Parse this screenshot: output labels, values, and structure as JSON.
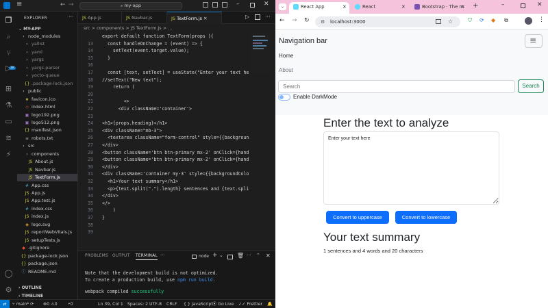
{
  "vscode": {
    "search_text": "my-app",
    "explorer_label": "EXPLORER",
    "project": "MY-APP",
    "tree": [
      {
        "label": "node_modules",
        "depth": 1,
        "kind": "folder",
        "color": "#ccc"
      },
      {
        "label": "yallist",
        "depth": 2,
        "kind": "folder",
        "color": "#8b8b8b"
      },
      {
        "label": "yaml",
        "depth": 2,
        "kind": "folder",
        "color": "#8b8b8b"
      },
      {
        "label": "yargs",
        "depth": 2,
        "kind": "folder",
        "color": "#8b8b8b"
      },
      {
        "label": "yargs-parser",
        "depth": 2,
        "kind": "folder",
        "color": "#8b8b8b"
      },
      {
        "label": "yocto-queue",
        "depth": 2,
        "kind": "folder",
        "color": "#8b8b8b"
      },
      {
        "label": ".package-lock.json",
        "depth": 2,
        "kind": "json",
        "color": "#8b8b8b"
      },
      {
        "label": "public",
        "depth": 1,
        "kind": "folder",
        "color": "#ccc"
      },
      {
        "label": "favicon.ico",
        "depth": 2,
        "kind": "ico",
        "color": "#ccc"
      },
      {
        "label": "index.html",
        "depth": 2,
        "kind": "html",
        "color": "#ccc"
      },
      {
        "label": "logo192.png",
        "depth": 2,
        "kind": "img",
        "color": "#ccc"
      },
      {
        "label": "logo512.png",
        "depth": 2,
        "kind": "img",
        "color": "#ccc"
      },
      {
        "label": "manifest.json",
        "depth": 2,
        "kind": "json",
        "color": "#ccc"
      },
      {
        "label": "robots.txt",
        "depth": 2,
        "kind": "txt",
        "color": "#ccc"
      },
      {
        "label": "src",
        "depth": 1,
        "kind": "folder",
        "color": "#ccc"
      },
      {
        "label": "components",
        "depth": 2,
        "kind": "folder",
        "color": "#ccc"
      },
      {
        "label": "About.js",
        "depth": 3,
        "kind": "js",
        "color": "#ccc"
      },
      {
        "label": "Navbar.js",
        "depth": 3,
        "kind": "js",
        "color": "#ccc"
      },
      {
        "label": "TextForm.js",
        "depth": 3,
        "kind": "js",
        "color": "#fff",
        "selected": true
      },
      {
        "label": "App.css",
        "depth": 2,
        "kind": "css",
        "color": "#ccc"
      },
      {
        "label": "App.js",
        "depth": 2,
        "kind": "js",
        "color": "#ccc"
      },
      {
        "label": "App.test.js",
        "depth": 2,
        "kind": "js",
        "color": "#ccc"
      },
      {
        "label": "index.css",
        "depth": 2,
        "kind": "css",
        "color": "#ccc"
      },
      {
        "label": "index.js",
        "depth": 2,
        "kind": "js",
        "color": "#ccc"
      },
      {
        "label": "logo.svg",
        "depth": 2,
        "kind": "svg",
        "color": "#ccc"
      },
      {
        "label": "reportWebVitals.js",
        "depth": 2,
        "kind": "js",
        "color": "#ccc"
      },
      {
        "label": "setupTests.js",
        "depth": 2,
        "kind": "js",
        "color": "#ccc"
      },
      {
        "label": ".gitignore",
        "depth": 1,
        "kind": "git",
        "color": "#ccc"
      },
      {
        "label": "package-lock.json",
        "depth": 1,
        "kind": "json",
        "color": "#ccc"
      },
      {
        "label": "package.json",
        "depth": 1,
        "kind": "json",
        "color": "#ccc"
      },
      {
        "label": "README.md",
        "depth": 1,
        "kind": "md",
        "color": "#ccc"
      }
    ],
    "outline_label": "OUTLINE",
    "timeline_label": "TIMELINE",
    "tabs": [
      {
        "label": "App.js"
      },
      {
        "label": "Navbar.js"
      },
      {
        "label": "TextForm.js",
        "active": true
      }
    ],
    "breadcrumb": "src > components > JS TextForm.js > ...",
    "code": [
      {
        "n": "",
        "t": "export default function TextForm(props ){"
      },
      {
        "n": "13",
        "t": "  const handleOnChange = (event) => {"
      },
      {
        "n": "14",
        "t": "    setText(event.target.value);"
      },
      {
        "n": "15",
        "t": "  }"
      },
      {
        "n": "16",
        "t": ""
      },
      {
        "n": "17",
        "t": "  const [text, setText] = useState(\"Enter your text he"
      },
      {
        "n": "18",
        "t": "//setText(\"New text\");"
      },
      {
        "n": "19",
        "t": "    return ("
      },
      {
        "n": "20",
        "t": ""
      },
      {
        "n": "21",
        "t": "        <>"
      },
      {
        "n": "22",
        "t": "      <div className='container'>"
      },
      {
        "n": "23",
        "t": ""
      },
      {
        "n": "24",
        "t": "<h1>{props.heading}</h1>"
      },
      {
        "n": "25",
        "t": "<div className=\"mb-3\">"
      },
      {
        "n": "26",
        "t": "  <textarea className=\"form-control\" style={{backgroun"
      },
      {
        "n": "27",
        "t": "</div>"
      },
      {
        "n": "28",
        "t": "<button className='btn btn-primary mx-2' onClick={hand"
      },
      {
        "n": "29",
        "t": "<button className='btn btn-primary mx-2' onClick={hand"
      },
      {
        "n": "30",
        "t": "</div>"
      },
      {
        "n": "31",
        "t": "<div className='container my-3' style={{backgroundColo"
      },
      {
        "n": "32",
        "t": "  <h1>Your text summary</h1>"
      },
      {
        "n": "33",
        "t": "  <p>{text.split(\".\").length} sentences and {text.spli"
      },
      {
        "n": "34",
        "t": "</div>"
      },
      {
        "n": "35",
        "t": "</>"
      },
      {
        "n": "36",
        "t": "    )"
      },
      {
        "n": "37",
        "t": "}"
      },
      {
        "n": "38",
        "t": ""
      },
      {
        "n": "39",
        "t": ""
      }
    ],
    "panel_tabs": [
      "PROBLEMS",
      "OUTPUT",
      "TERMINAL"
    ],
    "terminal_shell": "node",
    "terminal_lines": [
      "Note that the development build is not optimized.",
      "To create a production build, use ",
      "npm run build",
      "."
    ],
    "compiled": "webpack compiled ",
    "compiled_ok": "successfully",
    "status": {
      "branch": "main*",
      "errors": "0",
      "warnings": "0",
      "ports": "0",
      "position": "Ln 39, Col 1",
      "spaces": "Spaces: 2",
      "encoding": "UTF-8",
      "eol": "CRLF",
      "lang": "JavaScript",
      "golive": "Go Live",
      "prettier": "Prettier"
    }
  },
  "browser": {
    "tabs": [
      {
        "label": "React App",
        "active": true
      },
      {
        "label": "React"
      },
      {
        "label": "Bootstrap · The m"
      }
    ],
    "url": "localhost:3000",
    "navbar": {
      "brand": "Navigation bar",
      "links": [
        "Home",
        "About"
      ],
      "search_placeholder": "Search",
      "search_button": "Search",
      "dark_mode": "Enable DarkMode"
    },
    "heading": "Enter the text to analyze",
    "textarea_value": "Enter your text here",
    "btn_upper": "Convert to uppercase",
    "btn_lower": "Convert to lowercase",
    "summary_title": "Your text summary",
    "summary_text": "1 sentences and 4 words and 20 characters",
    "colors": {
      "primary": "#0d6efd",
      "pink": "#f5c4dc"
    }
  }
}
